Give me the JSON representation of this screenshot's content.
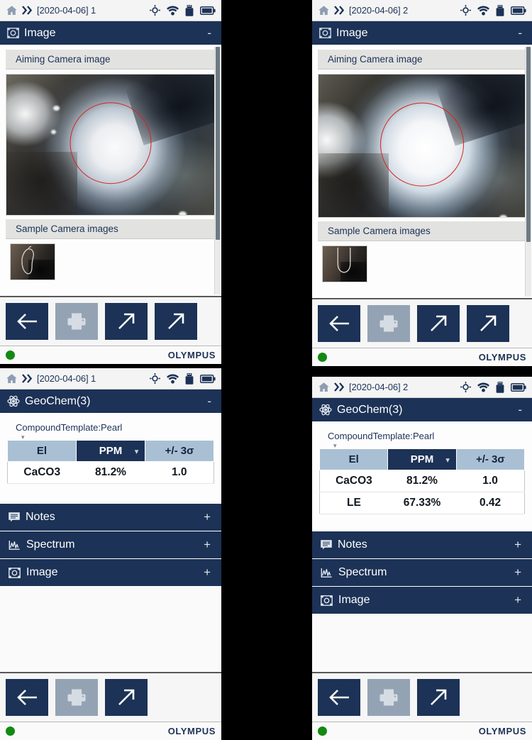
{
  "brand": "OLYMPUS",
  "status_icons": [
    "target-icon",
    "wifi-icon",
    "usb-drive-icon",
    "battery-icon"
  ],
  "panels": {
    "top_left": {
      "statusbar": {
        "home": "home-icon",
        "chevrons": ">>",
        "title": "[2020-04-06] 1"
      },
      "section": {
        "icon": "image-icon",
        "label": "Image",
        "toggle": "-"
      },
      "aiming_label": "Aiming Camera image",
      "sample_label": "Sample Camera images",
      "toolbar": [
        {
          "name": "back-button",
          "glyph": "←",
          "disabled": false
        },
        {
          "name": "print-button",
          "glyph": "printer-icon",
          "disabled": true
        },
        {
          "name": "export-button",
          "glyph": "↗",
          "disabled": false
        },
        {
          "name": "share-button",
          "glyph": "↗",
          "disabled": false
        }
      ]
    },
    "top_right": {
      "statusbar": {
        "home": "home-icon",
        "chevrons": ">>",
        "title": "[2020-04-06] 2"
      },
      "section": {
        "icon": "image-icon",
        "label": "Image",
        "toggle": "-"
      },
      "aiming_label": "Aiming Camera image",
      "sample_label": "Sample Camera images",
      "toolbar": [
        {
          "name": "back-button",
          "glyph": "←",
          "disabled": false
        },
        {
          "name": "print-button",
          "glyph": "printer-icon",
          "disabled": true
        },
        {
          "name": "export-button",
          "glyph": "↗",
          "disabled": false
        },
        {
          "name": "share-button",
          "glyph": "↗",
          "disabled": false
        }
      ]
    },
    "bottom_left": {
      "statusbar": {
        "home": "home-icon",
        "chevrons": ">>",
        "title": "[2020-04-06] 1"
      },
      "section": {
        "icon": "atom-icon",
        "label": "GeoChem(3)",
        "toggle": "-"
      },
      "compound_template": "CompoundTemplate:Pearl",
      "table": {
        "headers": [
          "El",
          "PPM",
          "+/- 3σ"
        ],
        "selected_header_index": 1,
        "rows": [
          {
            "el": "CaCO3",
            "ppm": "81.2%",
            "sigma": "1.0"
          }
        ]
      },
      "accordion": [
        {
          "icon": "notes-icon",
          "label": "Notes",
          "toggle": "+"
        },
        {
          "icon": "spectrum-icon",
          "label": "Spectrum",
          "toggle": "+"
        },
        {
          "icon": "image-icon",
          "label": "Image",
          "toggle": "+"
        }
      ],
      "toolbar": [
        {
          "name": "back-button",
          "glyph": "←",
          "disabled": false
        },
        {
          "name": "print-button",
          "glyph": "printer-icon",
          "disabled": true
        },
        {
          "name": "export-button",
          "glyph": "↗",
          "disabled": false
        }
      ]
    },
    "bottom_right": {
      "statusbar": {
        "home": "home-icon",
        "chevrons": ">>",
        "title": "[2020-04-06] 2"
      },
      "section": {
        "icon": "atom-icon",
        "label": "GeoChem(3)",
        "toggle": "-"
      },
      "compound_template": "CompoundTemplate:Pearl",
      "table": {
        "headers": [
          "El",
          "PPM",
          "+/- 3σ"
        ],
        "selected_header_index": 1,
        "rows": [
          {
            "el": "CaCO3",
            "ppm": "81.2%",
            "sigma": "1.0"
          },
          {
            "el": "LE",
            "ppm": "67.33%",
            "sigma": "0.42"
          }
        ]
      },
      "accordion": [
        {
          "icon": "notes-icon",
          "label": "Notes",
          "toggle": "+"
        },
        {
          "icon": "spectrum-icon",
          "label": "Spectrum",
          "toggle": "+"
        },
        {
          "icon": "image-icon",
          "label": "Image",
          "toggle": "+"
        }
      ],
      "toolbar": [
        {
          "name": "back-button",
          "glyph": "←",
          "disabled": false
        },
        {
          "name": "print-button",
          "glyph": "printer-icon",
          "disabled": true
        },
        {
          "name": "export-button",
          "glyph": "↗",
          "disabled": false
        }
      ]
    }
  },
  "colors": {
    "header_blue": "#1c3256",
    "header_light_blue": "#a9c0d4",
    "led_green": "#128a12",
    "target_circle_red": "#d6241e",
    "disabled_gray": "#94a3b4"
  }
}
